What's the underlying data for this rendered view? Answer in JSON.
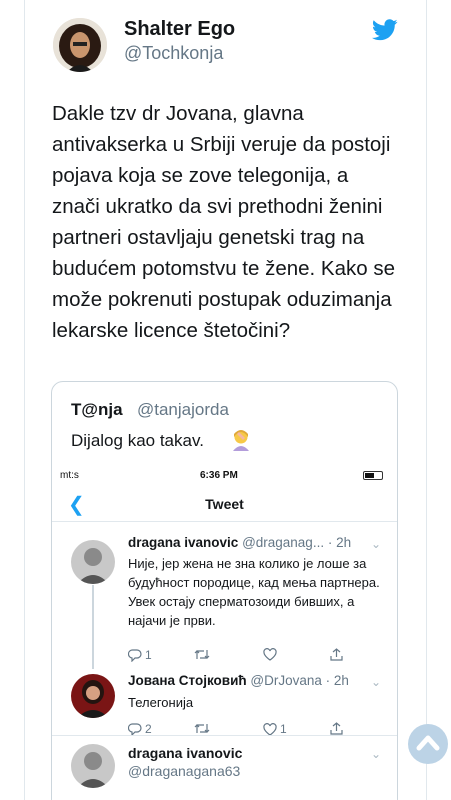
{
  "tweet": {
    "author_name": "Shalter Ego",
    "author_handle": "@Tochkonja",
    "text": "Dakle tzv dr Jovana, glavna antivakserka u Srbiji veruje da postoji pojava koja se zove telegonija, a znači ukratko da svi prethodni ženini partneri ostavljaju genetski trag na budućem potomstvu te žene. Kako se može pokrenuti postupak oduzimanja lekarske licence štetočini?"
  },
  "quoted_tweet": {
    "author_name": "T@nja",
    "author_handle": "@tanjajorda",
    "text": "Dijalog kao takav."
  },
  "screenshot": {
    "status_left": "mt:s",
    "status_time": "6:36 PM",
    "nav_title": "Tweet",
    "replies": [
      {
        "name": "dragana ivanovic",
        "handle": "@draganag... · 2h",
        "body": "Није, јер жена не зна колико је лоше за будућност породице, кад мења партнера.\nУвек остају сперматозоиди бивших, а најачи је први.",
        "reply_count": "1",
        "retweet_count": "",
        "like_count": ""
      },
      {
        "name": "Јована Стојковић",
        "handle": "@DrJovana · 2h",
        "body": "Телегонија",
        "reply_count": "2",
        "retweet_count": "",
        "like_count": "1"
      },
      {
        "name": "dragana ivanovic",
        "handle": "@draganagana63",
        "body": ""
      }
    ]
  },
  "colors": {
    "twitter_blue": "#1da1f2",
    "secondary_text": "#657786",
    "border": "#ccd6dd"
  },
  "icons": [
    "twitter-bird-icon",
    "back-chevron-icon",
    "reply-icon",
    "retweet-icon",
    "like-icon",
    "share-icon",
    "chevron-down-icon",
    "scroll-up-icon",
    "facepalm-emoji-icon"
  ]
}
